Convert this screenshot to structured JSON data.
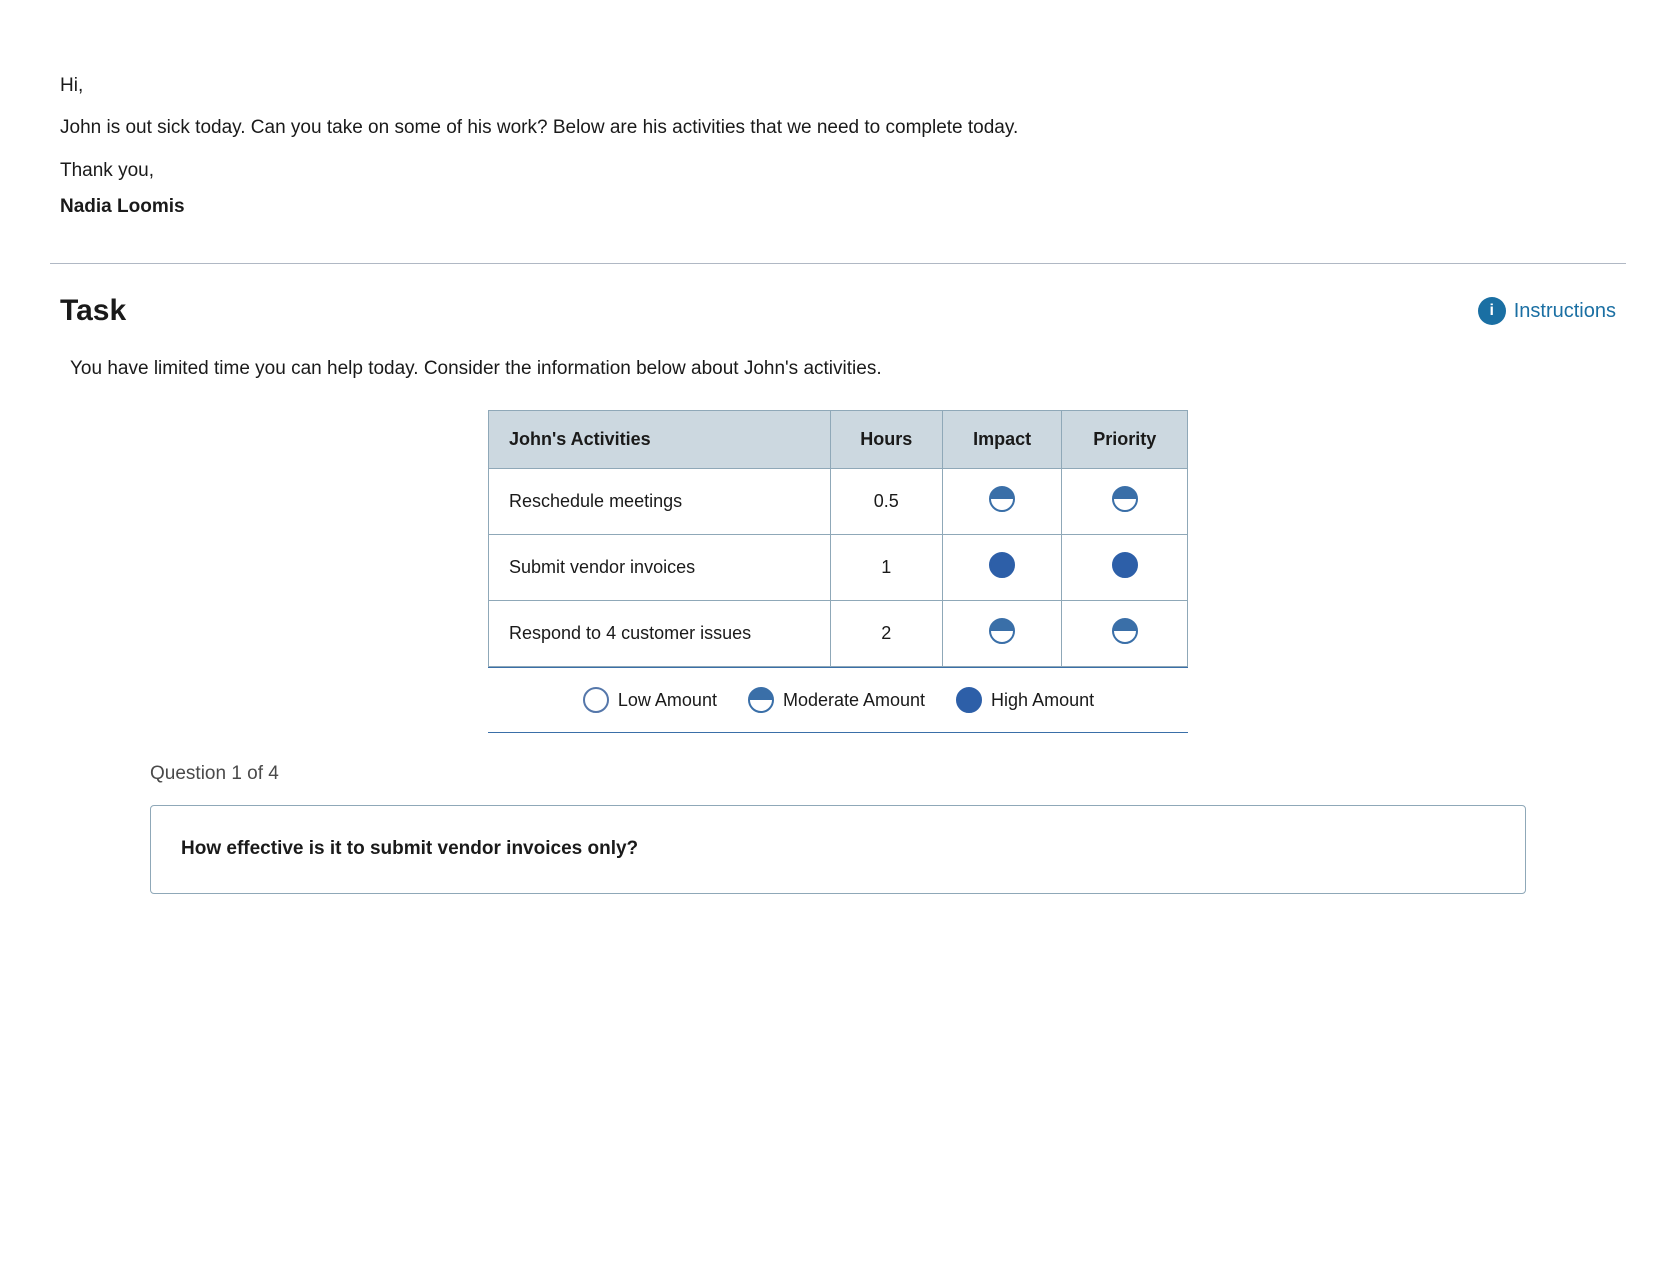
{
  "email": {
    "greeting": "Hi,",
    "body": "John is out sick today. Can you take on some of his work? Below are his activities that we need to complete today.",
    "thanks": "Thank you,",
    "sender": "Nadia Loomis"
  },
  "task": {
    "title": "Task",
    "instructions_label": "Instructions",
    "description": "You have limited time you can help today. Consider the information below about John's activities.",
    "table": {
      "headers": [
        "John's Activities",
        "Hours",
        "Impact",
        "Priority"
      ],
      "rows": [
        {
          "activity": "Reschedule meetings",
          "hours": "0.5",
          "impact": "moderate",
          "priority": "moderate"
        },
        {
          "activity": "Submit vendor invoices",
          "hours": "1",
          "impact": "high",
          "priority": "high"
        },
        {
          "activity": "Respond to 4 customer issues",
          "hours": "2",
          "impact": "moderate",
          "priority": "moderate"
        }
      ]
    },
    "legend": {
      "items": [
        {
          "label": "Low Amount",
          "type": "low"
        },
        {
          "label": "Moderate Amount",
          "type": "moderate"
        },
        {
          "label": "High Amount",
          "type": "high"
        }
      ]
    },
    "question": {
      "label": "Question 1 of 4",
      "text_prefix": "How effective is it to ",
      "text_bold": "submit vendor invoices only?",
      "text_suffix": ""
    }
  }
}
